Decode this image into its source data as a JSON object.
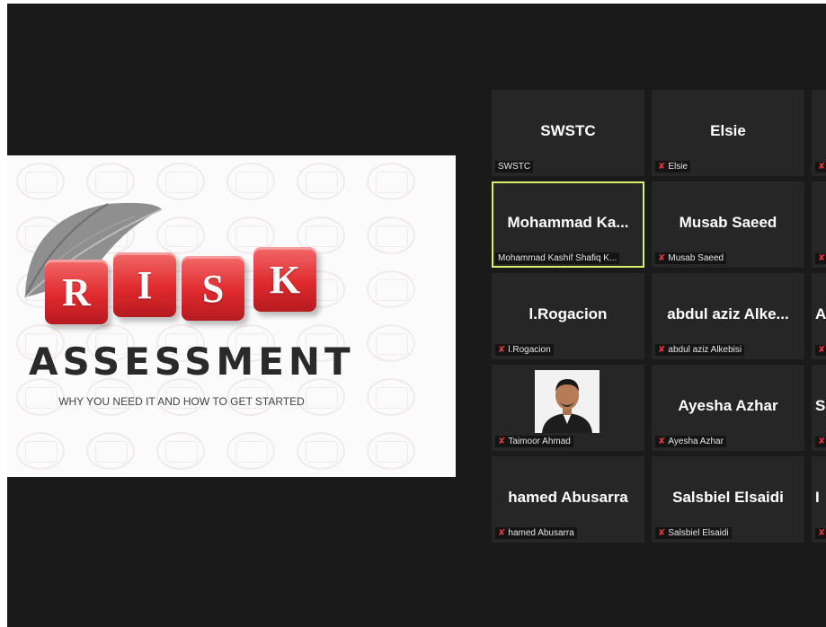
{
  "share": {
    "slide_letters": [
      "R",
      "I",
      "S",
      "K"
    ],
    "slide_title": "ASSESSMENT",
    "slide_subtitle": "WHY YOU NEED IT AND HOW TO GET STARTED"
  },
  "participants": [
    {
      "display": "SWSTC",
      "label": "SWSTC",
      "muted": false,
      "active": false,
      "has_video": false
    },
    {
      "display": "Elsie",
      "label": "Elsie",
      "muted": true,
      "active": false,
      "has_video": false
    },
    {
      "display": "Mohammad  Ka...",
      "label": "Mohammad Kashif Shafiq K...",
      "muted": false,
      "active": true,
      "has_video": false
    },
    {
      "display": "Musab Saeed",
      "label": "Musab Saeed",
      "muted": true,
      "active": false,
      "has_video": false
    },
    {
      "display": "l.Rogacion",
      "label": "l.Rogacion",
      "muted": true,
      "active": false,
      "has_video": false
    },
    {
      "display": "abdul  aziz  Alke...",
      "label": "abdul aziz Alkebisi",
      "muted": true,
      "active": false,
      "has_video": false
    },
    {
      "display": "",
      "label": "Taimoor Ahmad",
      "muted": true,
      "active": false,
      "has_video": true
    },
    {
      "display": "Ayesha Azhar",
      "label": "Ayesha Azhar",
      "muted": true,
      "active": false,
      "has_video": false
    },
    {
      "display": "hamed Abusarra",
      "label": "hamed Abusarra",
      "muted": true,
      "active": false,
      "has_video": false
    },
    {
      "display": "Salsbiel Elsaidi",
      "label": "Salsbiel Elsaidi",
      "muted": true,
      "active": false,
      "has_video": false
    }
  ],
  "partial_tiles": [
    {
      "display": "",
      "muted": true
    },
    {
      "display": "",
      "muted": true
    },
    {
      "display": "A",
      "muted": true
    },
    {
      "display": "Sa",
      "muted": true
    },
    {
      "display": "I",
      "muted": true
    }
  ],
  "icons": {
    "muted": "mic-muted-icon"
  },
  "colors": {
    "active_speaker": "#d6f26b",
    "muted_mic": "#e0383a",
    "tile_bg": "#262626",
    "stage_bg": "#1a1a1a"
  }
}
